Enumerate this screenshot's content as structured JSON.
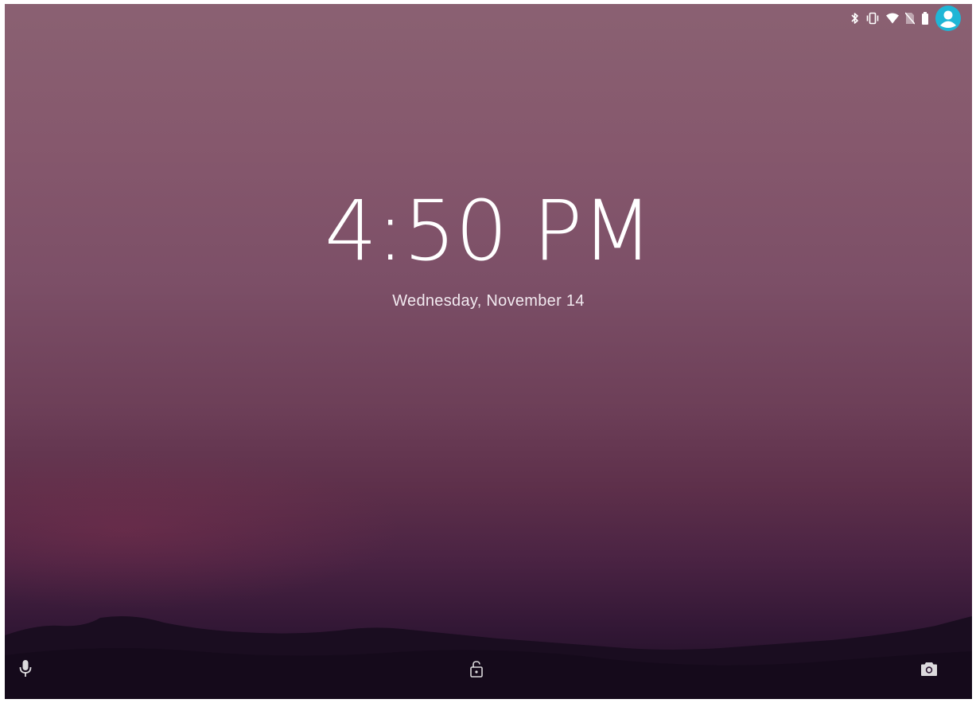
{
  "lockscreen": {
    "time": "4:50 PM",
    "date": "Wednesday, November 14"
  },
  "status_bar": {
    "icons": [
      "bluetooth-icon",
      "vibrate-icon",
      "wifi-icon",
      "no-sim-icon",
      "battery-icon",
      "user-avatar-icon"
    ],
    "avatar_color": "#1fb6d6"
  },
  "bottom_actions": {
    "left": "microphone-icon",
    "center": "unlock-icon",
    "right": "camera-icon"
  },
  "colors": {
    "sky_top": "#8a6172",
    "sky_bottom": "#1c0f24",
    "hills": "#1a0d20"
  }
}
